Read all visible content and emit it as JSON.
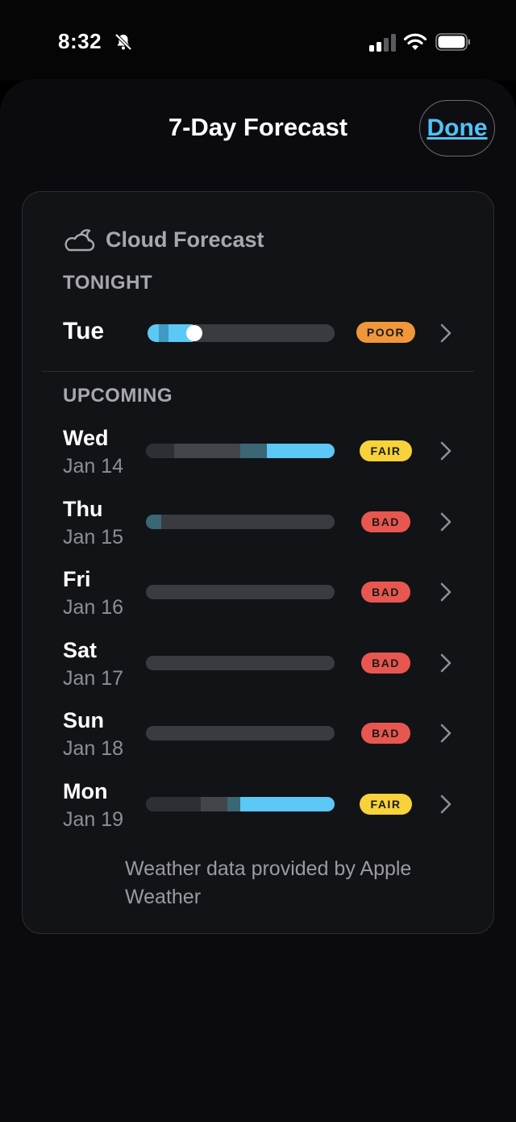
{
  "status": {
    "time": "8:32"
  },
  "header": {
    "title": "7-Day Forecast",
    "done_label": "Done"
  },
  "card": {
    "heading": "Cloud Forecast",
    "tonight_label": "TONIGHT",
    "upcoming_label": "UPCOMING",
    "footer": "Weather data provided by Apple Weather"
  },
  "tonight": {
    "day": "Tue",
    "rating": "POOR",
    "rating_color": "#f0973b",
    "bar": [
      {
        "frac": 0.06,
        "color": "#5bc8f5"
      },
      {
        "frac": 0.05,
        "color": "#3f9ac4"
      },
      {
        "frac": 0.13,
        "color": "#5bc8f5"
      },
      {
        "frac": 0.76,
        "color": "#3a3b40"
      }
    ],
    "marker": 0.25
  },
  "upcoming": [
    {
      "day": "Wed",
      "date": "Jan 14",
      "rating": "FAIR",
      "rating_color": "#f7d23a",
      "bar": [
        {
          "frac": 0.15,
          "color": "#2e2f34"
        },
        {
          "frac": 0.35,
          "color": "#44454b"
        },
        {
          "frac": 0.14,
          "color": "#3a6675"
        },
        {
          "frac": 0.36,
          "color": "#5bc8f5"
        }
      ]
    },
    {
      "day": "Thu",
      "date": "Jan 15",
      "rating": "BAD",
      "rating_color": "#e8574f",
      "bar": [
        {
          "frac": 0.08,
          "color": "#3a6675"
        },
        {
          "frac": 0.92,
          "color": "#3a3b40"
        }
      ]
    },
    {
      "day": "Fri",
      "date": "Jan 16",
      "rating": "BAD",
      "rating_color": "#e8574f",
      "bar": [
        {
          "frac": 1.0,
          "color": "#3a3b40"
        }
      ]
    },
    {
      "day": "Sat",
      "date": "Jan 17",
      "rating": "BAD",
      "rating_color": "#e8574f",
      "bar": [
        {
          "frac": 1.0,
          "color": "#3a3b40"
        }
      ]
    },
    {
      "day": "Sun",
      "date": "Jan 18",
      "rating": "BAD",
      "rating_color": "#e8574f",
      "bar": [
        {
          "frac": 1.0,
          "color": "#3a3b40"
        }
      ]
    },
    {
      "day": "Mon",
      "date": "Jan 19",
      "rating": "FAIR",
      "rating_color": "#f7d23a",
      "bar": [
        {
          "frac": 0.29,
          "color": "#2e2f34"
        },
        {
          "frac": 0.14,
          "color": "#44454b"
        },
        {
          "frac": 0.07,
          "color": "#3a6675"
        },
        {
          "frac": 0.5,
          "color": "#5bc8f5"
        }
      ]
    }
  ],
  "colors": {
    "accent": "#4fc3f7"
  }
}
